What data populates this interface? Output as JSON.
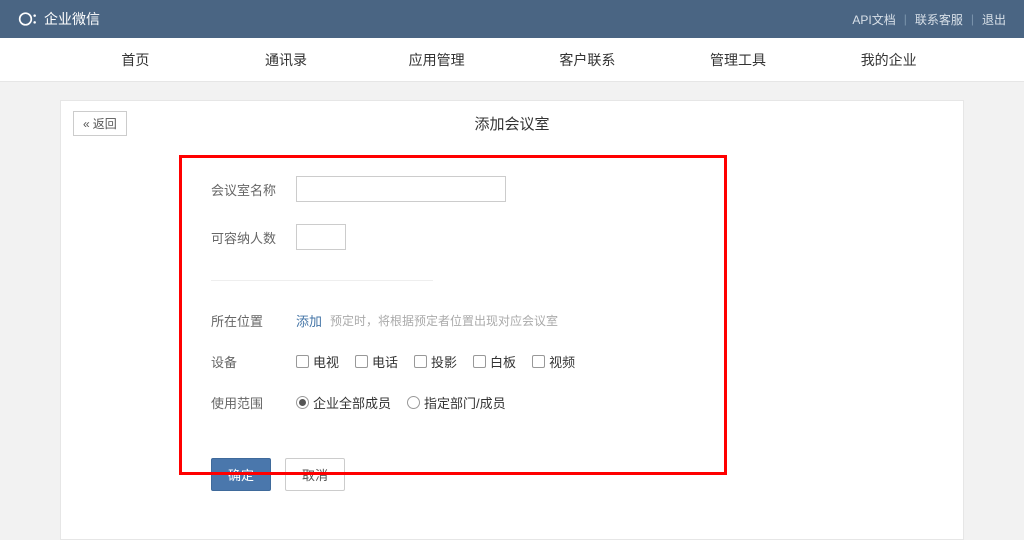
{
  "brand": {
    "name": "企业微信"
  },
  "topLinks": {
    "api": "API文档",
    "contact": "联系客服",
    "logout": "退出"
  },
  "nav": {
    "home": "首页",
    "contacts": "通讯录",
    "apps": "应用管理",
    "customers": "客户联系",
    "tools": "管理工具",
    "mycompany": "我的企业"
  },
  "panel": {
    "back": "返回",
    "title": "添加会议室"
  },
  "form": {
    "roomNameLabel": "会议室名称",
    "capacityLabel": "可容纳人数",
    "locationLabel": "所在位置",
    "addLink": "添加",
    "locationHint": "预定时，将根据预定者位置出现对应会议室",
    "equipmentLabel": "设备",
    "equipment": {
      "tv": "电视",
      "phone": "电话",
      "projector": "投影",
      "whiteboard": "白板",
      "video": "视频"
    },
    "scopeLabel": "使用范围",
    "scope": {
      "all": "企业全部成员",
      "specific": "指定部门/成员"
    }
  },
  "buttons": {
    "confirm": "确定",
    "cancel": "取消"
  }
}
